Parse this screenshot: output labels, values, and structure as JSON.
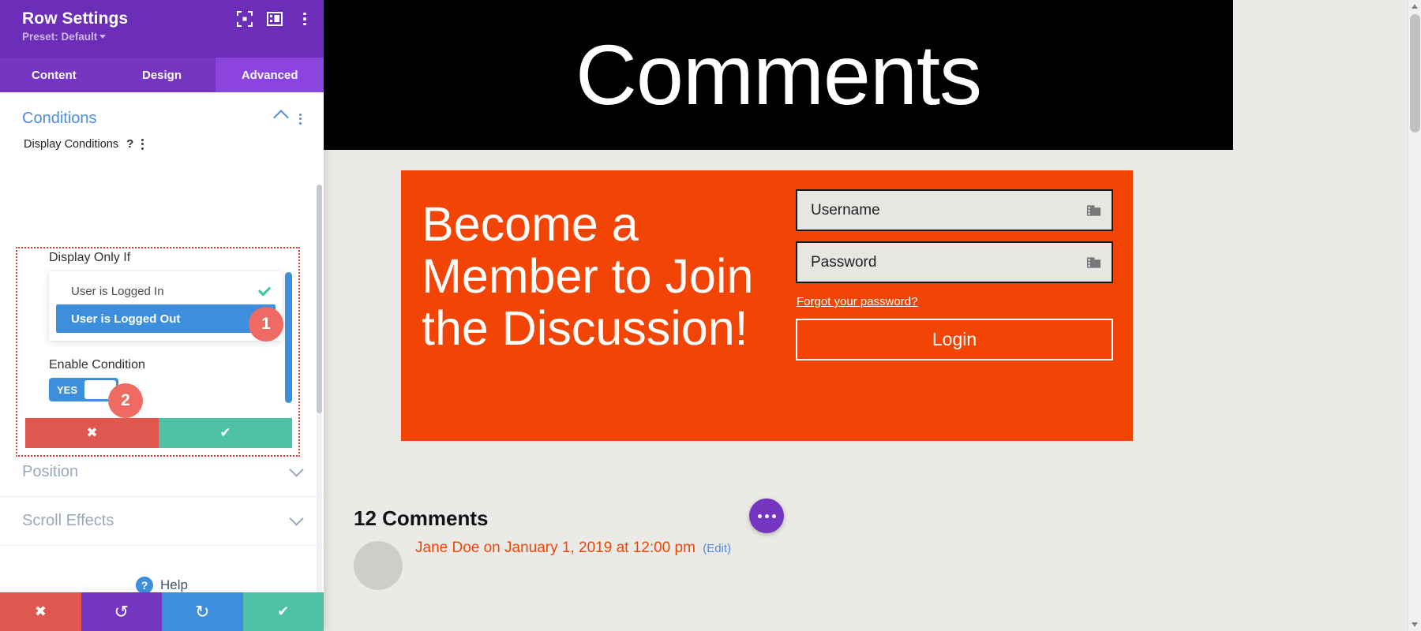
{
  "panel": {
    "title": "Row Settings",
    "preset_label": "Preset: Default",
    "header_icons": [
      {
        "name": "focus-frame-icon"
      },
      {
        "name": "layout-columns-icon"
      },
      {
        "name": "kebab-menu-icon"
      }
    ],
    "tabs": [
      {
        "label": "Content",
        "active": false
      },
      {
        "label": "Design",
        "active": false
      },
      {
        "label": "Advanced",
        "active": true
      }
    ],
    "section": {
      "title": "Conditions",
      "field_label": "Display Conditions",
      "help_glyph": "?"
    },
    "conditions": {
      "display_only_if_label": "Display Only If",
      "options": [
        {
          "label": "User is Logged In",
          "selected": false,
          "checked": true
        },
        {
          "label": "User is Logged Out",
          "selected": true,
          "checked": false
        }
      ],
      "enable_label": "Enable Condition",
      "toggle_value": "YES",
      "cancel_glyph": "✖",
      "confirm_glyph": "✔"
    },
    "badges": [
      {
        "number": "1"
      },
      {
        "number": "2"
      }
    ],
    "collapsed_sections": [
      {
        "label": "Position"
      },
      {
        "label": "Scroll Effects"
      }
    ],
    "help": {
      "label": "Help",
      "glyph": "?"
    },
    "footer_buttons": [
      {
        "name": "discard-button",
        "glyph": "✖",
        "color": "#e0574f"
      },
      {
        "name": "undo-button",
        "glyph": "↺",
        "color": "#7436c0"
      },
      {
        "name": "redo-button",
        "glyph": "↻",
        "color": "#3d8fdd"
      },
      {
        "name": "save-button",
        "glyph": "✔",
        "color": "#4fc1a6"
      }
    ]
  },
  "stage": {
    "hero_title": "Comments",
    "cta": {
      "heading": "Become a Member to Join the Discussion!",
      "username_placeholder": "Username",
      "password_placeholder": "Password",
      "forgot_link": "Forgot your password?",
      "login_label": "Login",
      "background_color": "#f24405"
    },
    "comments": {
      "count_label": "12 Comments",
      "first_comment_meta": "Jane Doe on January 1, 2019 at 12:00 pm",
      "edit_label": "(Edit)"
    },
    "fab_name": "more-options-fab"
  }
}
